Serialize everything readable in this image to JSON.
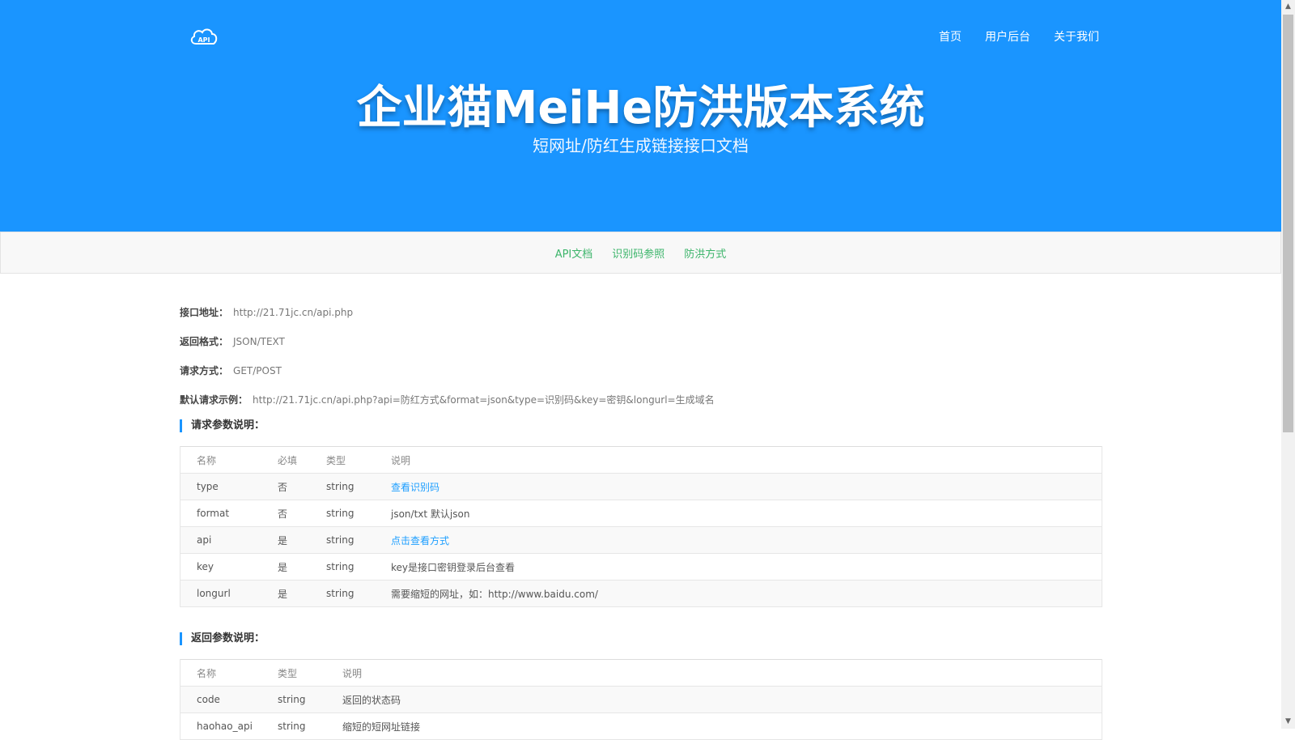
{
  "header": {
    "logo_text": "API",
    "nav": [
      "首页",
      "用户后台",
      "关于我们"
    ],
    "title": "企业猫MeiHe防洪版本系统",
    "subtitle": "短网址/防红生成链接接口文档"
  },
  "subnav": [
    "API文档",
    "识别码参照",
    "防洪方式"
  ],
  "info": [
    {
      "label": "接口地址：",
      "value": "http://21.71jc.cn/api.php"
    },
    {
      "label": "返回格式：",
      "value": "JSON/TEXT"
    },
    {
      "label": "请求方式：",
      "value": "GET/POST"
    },
    {
      "label": "默认请求示例：",
      "value": "http://21.71jc.cn/api.php?api=防红方式&format=json&type=识别码&key=密钥&longurl=生成域名"
    }
  ],
  "request_section": {
    "title": "请求参数说明：",
    "headers": [
      "名称",
      "必填",
      "类型",
      "说明"
    ],
    "rows": [
      {
        "name": "type",
        "required": "否",
        "type": "string",
        "desc": "查看识别码"
      },
      {
        "name": "format",
        "required": "否",
        "type": "string",
        "desc": "json/txt 默认json"
      },
      {
        "name": "api",
        "required": "是",
        "type": "string",
        "desc": "点击查看方式"
      },
      {
        "name": "key",
        "required": "是",
        "type": "string",
        "desc": "key是接口密钥登录后台查看"
      },
      {
        "name": "longurl",
        "required": "是",
        "type": "string",
        "desc": "需要缩短的网址，如：http://www.baidu.com/"
      }
    ]
  },
  "response_section": {
    "title": "返回参数说明：",
    "headers": [
      "名称",
      "类型",
      "说明"
    ],
    "rows": [
      {
        "name": "code",
        "type": "string",
        "desc": "返回的状态码"
      },
      {
        "name": "haohao_api",
        "type": "string",
        "desc": "缩短的短网址链接"
      }
    ]
  },
  "colors": {
    "accent": "#1a95ff",
    "subnav_link": "#3db56b",
    "link": "#1e9fff"
  }
}
